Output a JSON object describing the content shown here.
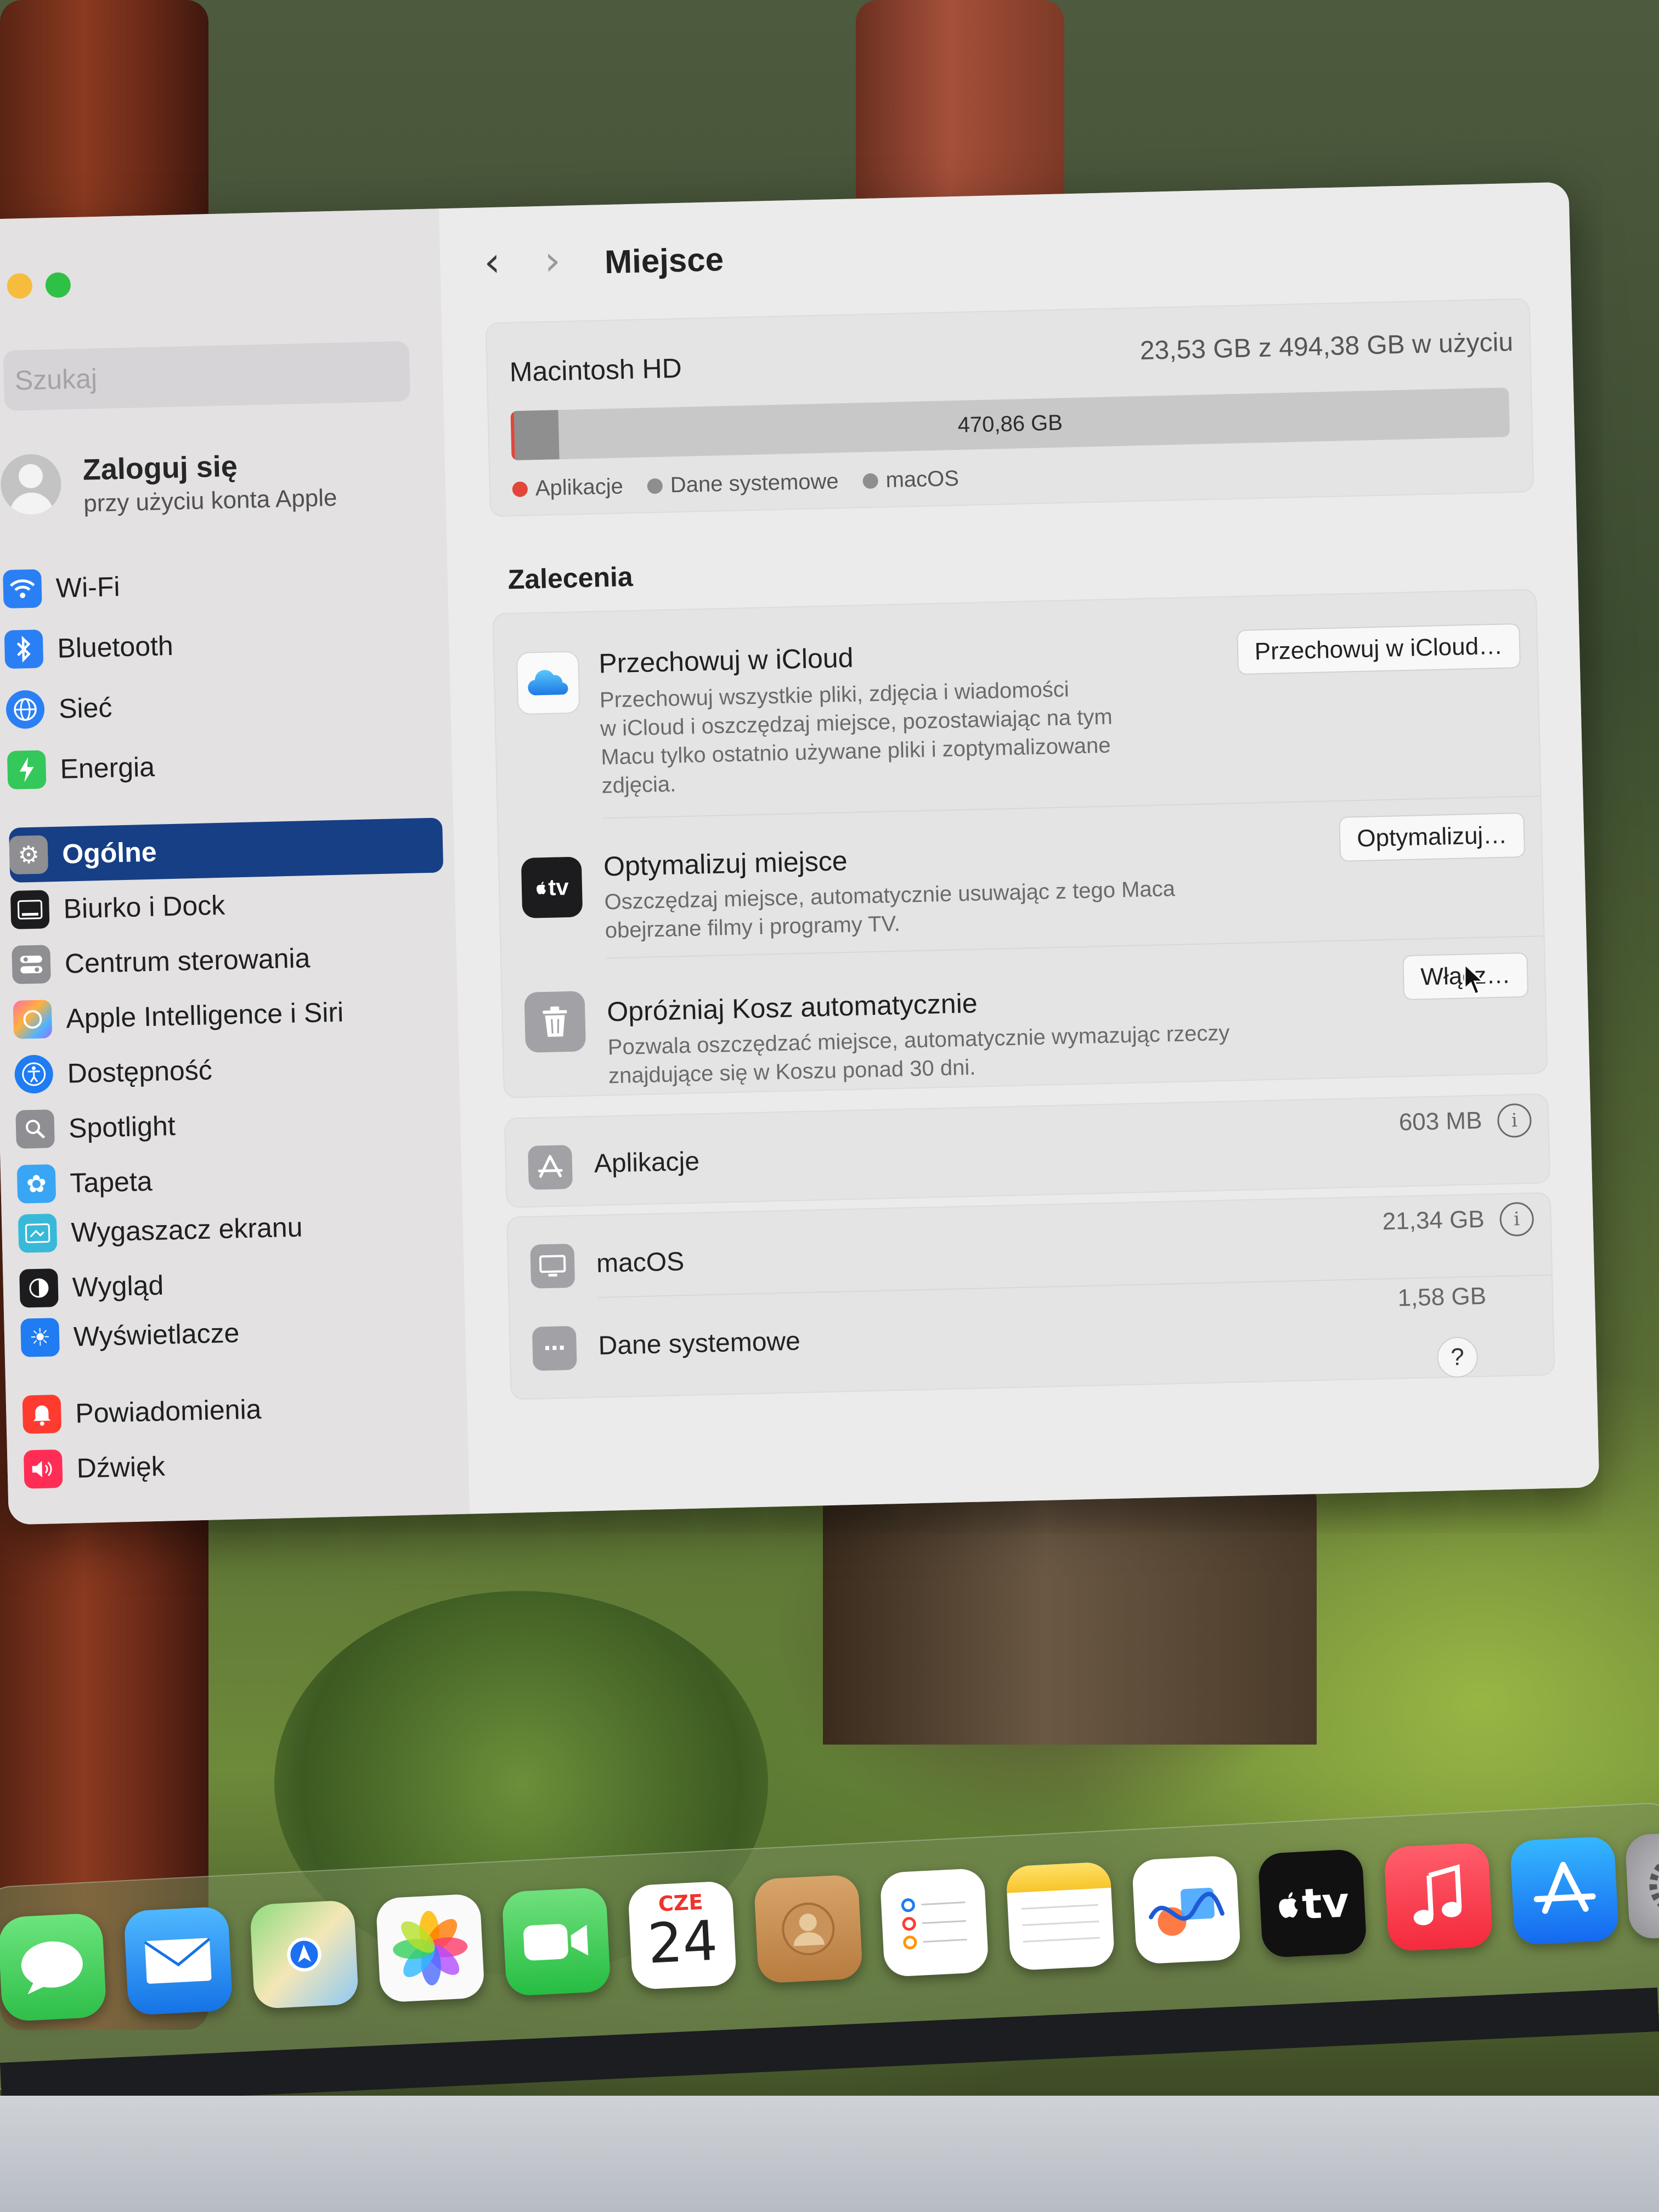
{
  "sidebar": {
    "search_placeholder": "Szukaj",
    "account_title": "Zaloguj się",
    "account_subtitle": "przy użyciu konta Apple",
    "items": [
      {
        "label": "Wi-Fi"
      },
      {
        "label": "Bluetooth"
      },
      {
        "label": "Sieć"
      },
      {
        "label": "Energia"
      },
      {
        "label": "Ogólne"
      },
      {
        "label": "Biurko i Dock"
      },
      {
        "label": "Centrum sterowania"
      },
      {
        "label": "Apple Intelligence i Siri"
      },
      {
        "label": "Dostępność"
      },
      {
        "label": "Spotlight"
      },
      {
        "label": "Tapeta"
      },
      {
        "label": "Wygaszacz ekranu"
      },
      {
        "label": "Wygląd"
      },
      {
        "label": "Wyświetlacze"
      },
      {
        "label": "Powiadomienia"
      },
      {
        "label": "Dźwięk"
      }
    ],
    "active_item": "Ogólne"
  },
  "toolbar": {
    "title": "Miejsce"
  },
  "disk": {
    "name": "Macintosh HD",
    "usage": "23,53 GB z 494,38 GB w użyciu",
    "available_label": "470,86 GB",
    "used_fraction": 0.048,
    "legend": [
      {
        "label": "Aplikacje",
        "color": "#e4453a"
      },
      {
        "label": "Dane systemowe",
        "color": "#8e8e8e"
      },
      {
        "label": "macOS",
        "color": "#8e8e8e"
      }
    ]
  },
  "recommendations": {
    "heading": "Zalecenia",
    "items": [
      {
        "title": "Przechowuj w iCloud",
        "description_lines": [
          "Przechowuj wszystkie pliki, zdjęcia i wiadomości",
          "w iCloud i oszczędzaj miejsce, pozostawiając na tym",
          "Macu tylko ostatnio używane pliki i zoptymalizowane",
          "zdjęcia."
        ],
        "button": "Przechowuj w iCloud…",
        "icon": "icloud-icon"
      },
      {
        "title": "Optymalizuj miejsce",
        "description_lines": [
          "Oszczędzaj miejsce, automatycznie usuwając z tego Maca",
          "obejrzane filmy i programy TV."
        ],
        "button": "Optymalizuj…",
        "icon": "apple-tv-icon",
        "icon_text": "tv"
      },
      {
        "title": "Opróżniaj Kosz automatycznie",
        "description_lines": [
          "Pozwala oszczędzać miejsce, automatycznie wymazując rzeczy",
          "znajdujące się w Koszu ponad 30 dni."
        ],
        "button": "Włącz…",
        "icon": "trash-icon"
      }
    ]
  },
  "categories": [
    {
      "name": "Aplikacje",
      "size": "603 MB",
      "icon": "app-store-icon"
    },
    {
      "name": "macOS",
      "size": "21,34 GB",
      "icon": "display-icon"
    },
    {
      "name": "Dane systemowe",
      "size": "1,58 GB",
      "icon": "ellipsis-icon"
    }
  ],
  "help_label": "?",
  "dock": {
    "calendar_month": "CZE",
    "calendar_day": "24",
    "tv_label": "tv",
    "apps": [
      "Wiadomości",
      "Mail",
      "Mapy",
      "Zdjęcia",
      "FaceTime",
      "Kalendarz",
      "Kontakty",
      "Przypomnienia",
      "Notatki",
      "Freeform",
      "TV",
      "Muzyka",
      "App Store",
      "Ustawienia systemowe"
    ]
  }
}
